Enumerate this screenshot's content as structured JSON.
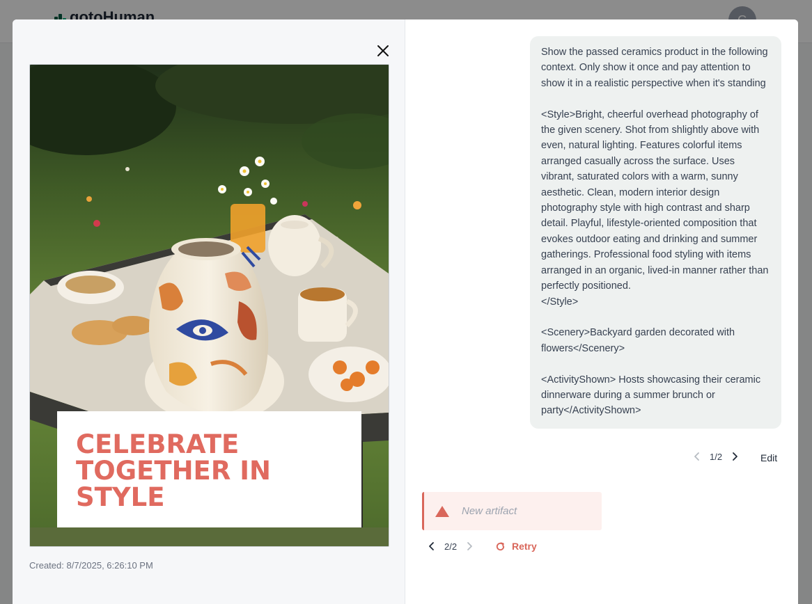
{
  "background": {
    "logo_text": "gotoHuman",
    "avatar_initial": "G"
  },
  "image_panel": {
    "headline": [
      "CELEBRATE",
      "TOGETHER IN",
      "STYLE"
    ],
    "created": "Created: 8/7/2025, 6:26:10 PM"
  },
  "prompt": {
    "text": "Show the passed ceramics product in the following context. Only show it once and pay attention to show it in a realistic perspective when it's standing\n\n<Style>Bright, cheerful overhead photography of the given scenery. Shot from shlightly above with even, natural lighting. Features colorful items arranged casually across the surface. Uses vibrant, saturated colors with a warm, sunny aesthetic. Clean, modern interior design photography style with high contrast and sharp detail. Playful, lifestyle-oriented composition that evokes outdoor eating and drinking and summer gatherings. Professional food styling with items arranged in an organic, lived-in manner rather than perfectly positioned.\n</Style>\n\n<Scenery>Backyard garden decorated with flowers</Scenery>\n\n<ActivityShown> Hosts showcasing their ceramic dinnerware during a summer brunch or party</ActivityShown>",
    "pager": "1/2",
    "edit_label": "Edit"
  },
  "artifact": {
    "label": "New artifact",
    "pager": "2/2",
    "retry_label": "Retry"
  },
  "colors": {
    "accent": "#d9675b",
    "headline": "#e06a5f",
    "bubble": "#eef1f0"
  }
}
